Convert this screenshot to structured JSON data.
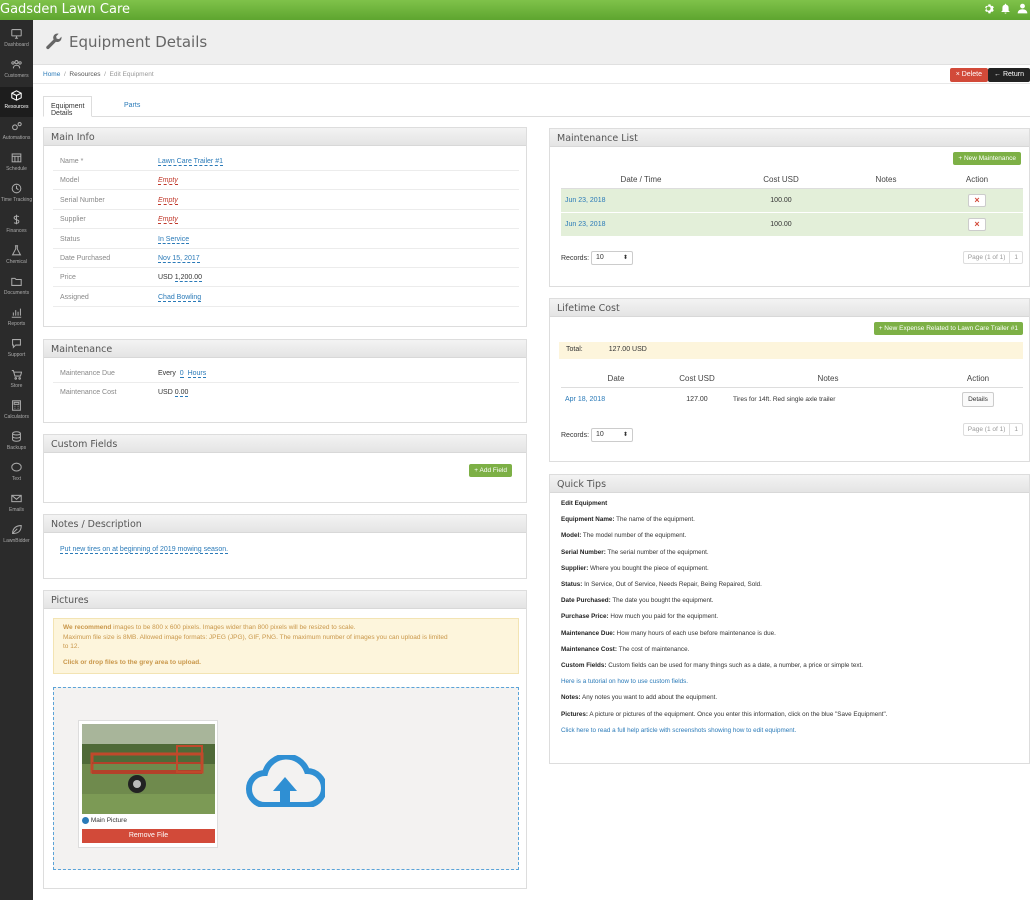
{
  "app": {
    "title": "Gadsden Lawn Care"
  },
  "topbar": {
    "icons": [
      "gear-icon",
      "bell-icon",
      "user-icon"
    ]
  },
  "sidebar": {
    "items": [
      {
        "label": "Dashboard",
        "icon": "monitor-icon"
      },
      {
        "label": "Customers",
        "icon": "people-icon"
      },
      {
        "label": "Resources",
        "icon": "cube-icon",
        "active": true
      },
      {
        "label": "Automations",
        "icon": "gears-icon"
      },
      {
        "label": "Schedule",
        "icon": "calendar-icon"
      },
      {
        "label": "Time Tracking",
        "icon": "clock-icon"
      },
      {
        "label": "Finances",
        "icon": "dollar-icon"
      },
      {
        "label": "Chemical",
        "icon": "flask-icon"
      },
      {
        "label": "Documents",
        "icon": "folder-icon"
      },
      {
        "label": "Reports",
        "icon": "chart-icon"
      },
      {
        "label": "Support",
        "icon": "chat-icon"
      },
      {
        "label": "Store",
        "icon": "cart-icon"
      },
      {
        "label": "Calculators",
        "icon": "calculator-icon"
      },
      {
        "label": "Backups",
        "icon": "database-icon"
      },
      {
        "label": "Text",
        "icon": "sms-icon"
      },
      {
        "label": "Emails",
        "icon": "envelope-icon"
      },
      {
        "label": "LawnBidder",
        "icon": "leaf-icon"
      }
    ]
  },
  "header": {
    "title": "Equipment Details"
  },
  "breadcrumb": {
    "home": "Home",
    "sep": "/",
    "resources": "Resources",
    "current": "Edit Equipment"
  },
  "actions": {
    "delete": "× Delete",
    "return": "← Return"
  },
  "tabs": {
    "details": "Equipment Details",
    "parts": "Parts"
  },
  "main_info": {
    "title": "Main Info",
    "rows": [
      {
        "label": "Name *",
        "value": "Lawn Care Trailer #1",
        "style": "link"
      },
      {
        "label": "Model",
        "value": "Empty",
        "style": "empty"
      },
      {
        "label": "Serial Number",
        "value": "Empty",
        "style": "empty"
      },
      {
        "label": "Supplier",
        "value": "Empty",
        "style": "empty"
      },
      {
        "label": "Status",
        "value": "In Service",
        "style": "link"
      },
      {
        "label": "Date Purchased",
        "value": "Nov 15, 2017",
        "style": "link"
      },
      {
        "label": "Price",
        "prefix": "USD",
        "value": "1,200.00",
        "style": "link"
      },
      {
        "label": "Assigned",
        "value": "Chad Bowling",
        "style": "link"
      }
    ]
  },
  "maintenance": {
    "title": "Maintenance",
    "due_label": "Maintenance Due",
    "due_prefix": "Every",
    "due_value": "0",
    "due_unit": "Hours",
    "cost_label": "Maintenance Cost",
    "cost_prefix": "USD",
    "cost_value": "0.00"
  },
  "custom_fields": {
    "title": "Custom Fields",
    "add_button": "+ Add Field"
  },
  "notes": {
    "title": "Notes / Description",
    "text": "Put new tires on at beginning of 2019 mowing season."
  },
  "pictures": {
    "title": "Pictures",
    "notice_bold": "We recommend",
    "notice_line1": " images to be 800 x 600 pixels. Images wider than 800 pixels will be resized to scale.",
    "notice_line2": "Maximum file size is 8MB. Allowed image formats: JPEG (JPG), GIF, PNG. The maximum number of images you can upload is limited",
    "notice_line3": "to 12.",
    "notice_drop": "Click or drop files to the grey area to upload.",
    "main_picture": "Main Picture",
    "remove": "Remove File"
  },
  "maintenance_list": {
    "title": "Maintenance List",
    "new_button": "+ New Maintenance",
    "columns": [
      "Date / Time",
      "Cost USD",
      "Notes",
      "Action"
    ],
    "rows": [
      {
        "date": "Jun 23, 2018",
        "cost": "100.00",
        "notes": ""
      },
      {
        "date": "Jun 23, 2018",
        "cost": "100.00",
        "notes": ""
      }
    ],
    "records_label": "Records:",
    "records_value": "10",
    "page_label": "Page (1 of 1)",
    "page_num": "1"
  },
  "lifetime_cost": {
    "title": "Lifetime Cost",
    "new_button": "+ New Expense Related to Lawn Care Trailer #1",
    "total_label": "Total:",
    "total_value": "127.00 USD",
    "columns": [
      "Date",
      "Cost USD",
      "Notes",
      "Action"
    ],
    "rows": [
      {
        "date": "Apr 18, 2018",
        "cost": "127.00",
        "notes": "Tires for 14ft. Red single axle trailer",
        "action": "Details"
      }
    ],
    "records_label": "Records:",
    "records_value": "10",
    "page_label": "Page (1 of 1)",
    "page_num": "1"
  },
  "quick_tips": {
    "title": "Quick Tips",
    "heading": "Edit Equipment",
    "items": [
      {
        "b": "Equipment Name:",
        "t": " The name of the equipment."
      },
      {
        "b": "Model:",
        "t": " The model number of the equipment."
      },
      {
        "b": "Serial Number:",
        "t": " The serial number of the equipment."
      },
      {
        "b": "Supplier:",
        "t": " Where you bought the piece of equipment."
      },
      {
        "b": "Status:",
        "t": " In Service, Out of Service, Needs Repair, Being Repaired, Sold."
      },
      {
        "b": "Date Purchased:",
        "t": " The date you bought the equipment."
      },
      {
        "b": "Purchase Price:",
        "t": " How much you paid for the equipment."
      },
      {
        "b": "Maintenance Due:",
        "t": " How many hours of each use before maintenance is due."
      },
      {
        "b": "Maintenance Cost:",
        "t": " The cost of maintenance."
      },
      {
        "b": "Custom Fields:",
        "t": " Custom fields can be used for many things such as a date, a number, a price or simple text."
      }
    ],
    "tutorial_link": "Here is a tutorial on how to use custom fields.",
    "items2": [
      {
        "b": "Notes:",
        "t": " Any notes you want to add about the equipment."
      },
      {
        "b": "Pictures:",
        "t": " A picture or pictures of the equipment. Once you enter this information, click on the blue \"Save Equipment\"."
      }
    ],
    "help_link": "Click here to read a full help article with screenshots showing how to edit equipment."
  },
  "colors": {
    "brand": "#6ab43a",
    "danger": "#d24a39",
    "link": "#2a7ab8",
    "row_green": "#e3efd9",
    "warn_bg": "#fdf5dc"
  }
}
